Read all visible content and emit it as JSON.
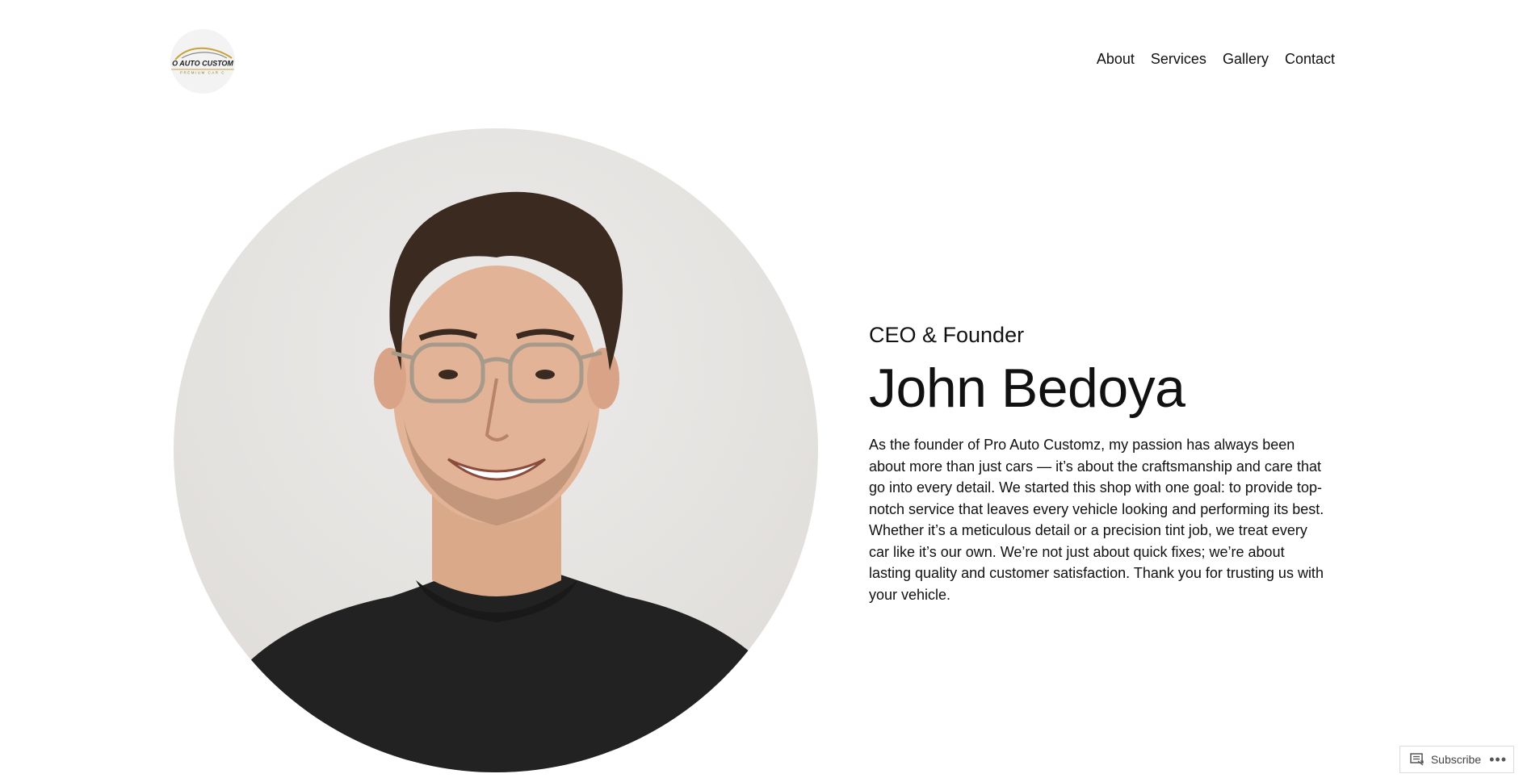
{
  "header": {
    "logo_text": "O AUTO CUSTOM",
    "logo_subtext": "PREMIUM CAR C",
    "nav": [
      {
        "label": "About"
      },
      {
        "label": "Services"
      },
      {
        "label": "Gallery"
      },
      {
        "label": "Contact"
      }
    ]
  },
  "profile": {
    "role": "CEO & Founder",
    "name": "John Bedoya",
    "bio": "As the founder of Pro Auto Customz, my passion has always been about more than just cars — it’s about the craftsmanship and care that go into every detail. We started this shop with one goal: to provide top-notch service that leaves every vehicle looking and performing its best. Whether it’s a meticulous detail or a precision tint job, we treat every car like it’s our own. We’re not just about quick fixes; we’re about lasting quality and customer satisfaction. Thank you for trusting us with your vehicle.",
    "photo_icon": "founder-portrait"
  },
  "footer_bar": {
    "subscribe_label": "Subscribe",
    "subscribe_icon": "reader-icon",
    "more_icon": "ellipsis-icon"
  },
  "colors": {
    "text": "#111111",
    "logo_gold": "#c9a23a",
    "background": "#ffffff"
  }
}
